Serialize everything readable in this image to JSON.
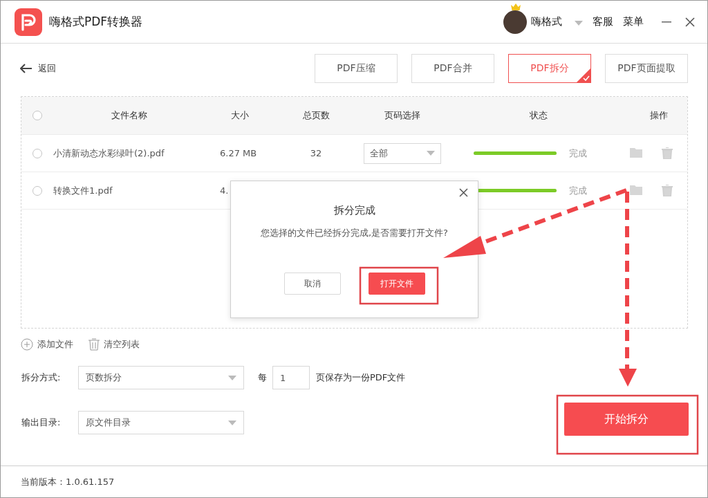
{
  "window": {
    "title": "嗨格式PDF转换器",
    "user": "嗨格式",
    "menu": [
      "客服",
      "菜单"
    ]
  },
  "back": "返回",
  "tabs": [
    {
      "label": "PDF压缩",
      "selected": false
    },
    {
      "label": "PDF合并",
      "selected": false
    },
    {
      "label": "PDF拆分",
      "selected": true
    },
    {
      "label": "PDF页面提取",
      "selected": false
    }
  ],
  "table": {
    "all_checked": false,
    "columns": [
      "文件名称",
      "大小",
      "总页数",
      "页码选择",
      "状态",
      "操作"
    ],
    "rows": [
      {
        "checked": false,
        "name": "小清新动态水彩绿叶(2).pdf",
        "size": "6.27 MB",
        "pages": "32",
        "page_select": "全部",
        "level": 1,
        "status": "完成"
      },
      {
        "checked": false,
        "name": "转换文件1.pdf",
        "size": "4.",
        "level": 1,
        "status": "完成"
      }
    ]
  },
  "list_actions": [
    "添加文件",
    "清空列表"
  ],
  "split_mode": {
    "label": "拆分方式:",
    "value": "页数拆分",
    "every": "每",
    "pages": "1",
    "suffix": "页保存为一份PDF文件"
  },
  "output_dir": {
    "label": "输出目录:",
    "value": "原文件目录"
  },
  "start_button": "开始拆分",
  "version": "当前版本：1.0.61.157",
  "dialog": {
    "title": "拆分完成",
    "message": "您选择的文件已经拆分完成,是否需要打开文件?",
    "buttons": [
      {
        "label": "取消",
        "primary": false
      },
      {
        "label": "打开文件",
        "primary": true
      }
    ]
  },
  "annotations": [
    {
      "kind": "frame"
    },
    {
      "kind": "frame"
    },
    {
      "kind": "arrow"
    },
    {
      "kind": "arrow"
    }
  ]
}
